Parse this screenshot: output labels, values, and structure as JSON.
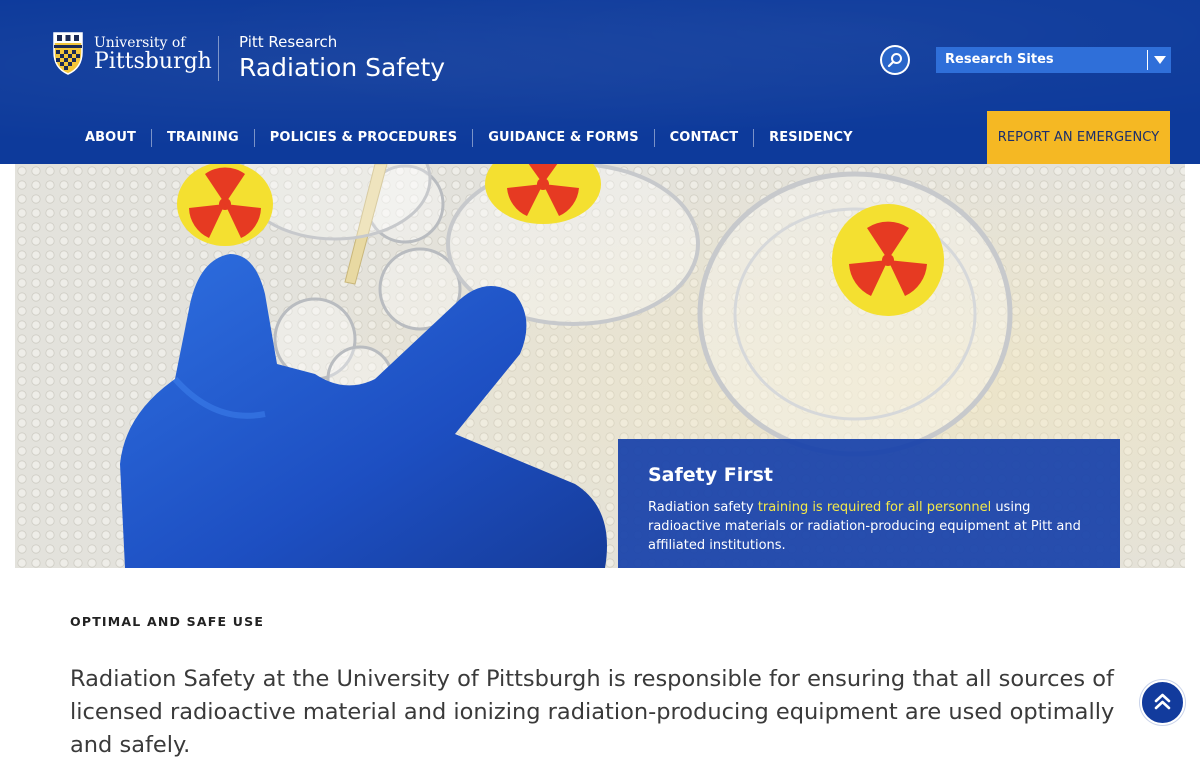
{
  "header": {
    "logo": {
      "line1": "University of",
      "line2": "Pittsburgh",
      "icon": "pitt-shield-icon"
    },
    "site_super": "Pitt Research",
    "site_title": "Radiation Safety",
    "search_icon": "search-icon",
    "research_select": {
      "selected": "Research Sites",
      "icon": "chevron-down-icon"
    },
    "nav": [
      {
        "label": "ABOUT"
      },
      {
        "label": "TRAINING"
      },
      {
        "label": "POLICIES & PROCEDURES"
      },
      {
        "label": "GUIDANCE & FORMS"
      },
      {
        "label": "CONTACT"
      },
      {
        "label": "RESIDENCY"
      }
    ],
    "emergency_label": "REPORT AN EMERGENCY"
  },
  "hero": {
    "image_icon": "lab-photo",
    "card": {
      "title": "Safety First",
      "text_before": "Radiation safety ",
      "link_text": "training is required for all personnel",
      "text_after": " using radioactive materials or radiation-producing equipment at Pitt and affiliated institutions."
    }
  },
  "main": {
    "eyebrow": "OPTIMAL AND SAFE USE",
    "lead": "Radiation Safety at the University of Pittsburgh is responsible for ensuring that all sources of licensed radioactive material and ionizing radiation-producing equipment are used optimally and safely."
  },
  "back_to_top_icon": "double-chevron-up-icon",
  "colors": {
    "header_bg": "#0d3a9b",
    "select_bg": "#2f6fd9",
    "emergency_bg": "#f5b823",
    "card_bg": "#1842aa",
    "link_highlight": "#f3e84a"
  }
}
